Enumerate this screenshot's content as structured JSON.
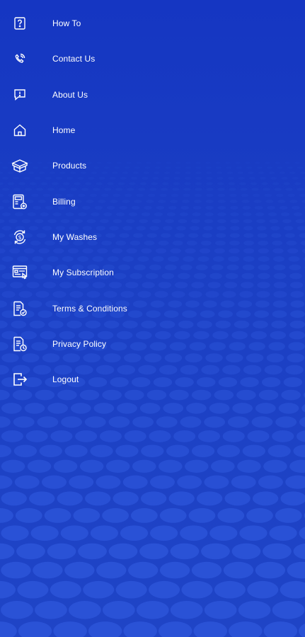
{
  "theme": {
    "background": "#1a3ec3",
    "dot_color": "#2a52d6",
    "text_color": "#ffffff"
  },
  "menu": {
    "items": [
      {
        "label": "How To",
        "icon": "question-icon"
      },
      {
        "label": "Contact Us",
        "icon": "phone-icon"
      },
      {
        "label": "About Us",
        "icon": "info-message-icon"
      },
      {
        "label": "Home",
        "icon": "home-icon"
      },
      {
        "label": "Products",
        "icon": "box-icon"
      },
      {
        "label": "Billing",
        "icon": "billing-icon"
      },
      {
        "label": "My Washes",
        "icon": "dollar-cycle-icon"
      },
      {
        "label": "My Subscription",
        "icon": "subscription-icon"
      },
      {
        "label": "Terms & Conditions",
        "icon": "document-check-icon"
      },
      {
        "label": "Privacy Policy",
        "icon": "document-shield-icon"
      },
      {
        "label": "Logout",
        "icon": "logout-icon"
      }
    ]
  }
}
